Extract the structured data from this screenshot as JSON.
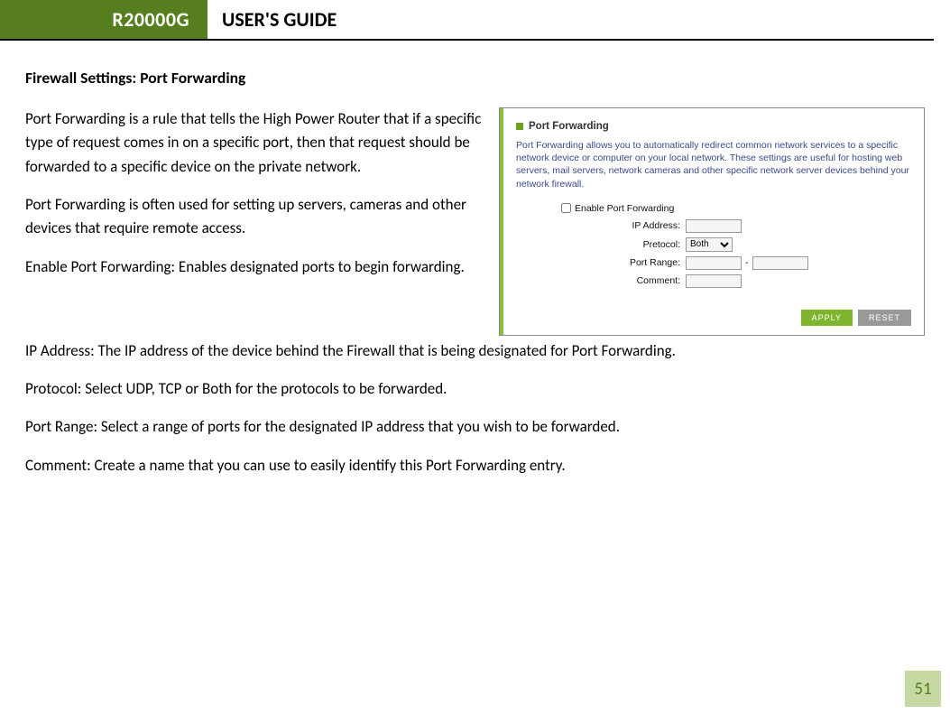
{
  "header": {
    "model": "R20000G",
    "title": "USER'S GUIDE"
  },
  "section_title": "Firewall Settings: Port Forwarding",
  "paragraphs_top": [
    "Port Forwarding is a rule that tells the High Power Router that if a specific type of request comes in on a specific port, then that request should be forwarded to a specific device on the private network.",
    "Port Forwarding is often used for setting up servers, cameras and other devices that require remote access.",
    "Enable Port Forwarding: Enables designated ports to begin forwarding."
  ],
  "paragraphs_full": [
    "IP Address:  The IP address of the device behind the Firewall that is being designated for Port Forwarding.",
    "Protocol: Select UDP, TCP or Both for the protocols to be forwarded.",
    "Port Range: Select a range of ports for the designated IP address that you wish to be forwarded.",
    "Comment: Create a name that you can use to easily identify this Port Forwarding entry."
  ],
  "panel": {
    "title": "Port Forwarding",
    "description": "Port Forwarding allows you to automatically redirect common network services to a specific network device or computer on your local network. These settings are useful for hosting web servers, mail servers, network cameras and other specific network server devices behind your network firewall.",
    "enable_label": "Enable Port Forwarding",
    "fields": {
      "ip_label": "IP Address:",
      "protocol_label": "Pretocol:",
      "protocol_value": "Both",
      "port_range_label": "Port Range:",
      "comment_label": "Comment:"
    },
    "buttons": {
      "apply": "APPLY",
      "reset": "RESET"
    }
  },
  "page_number": "51"
}
